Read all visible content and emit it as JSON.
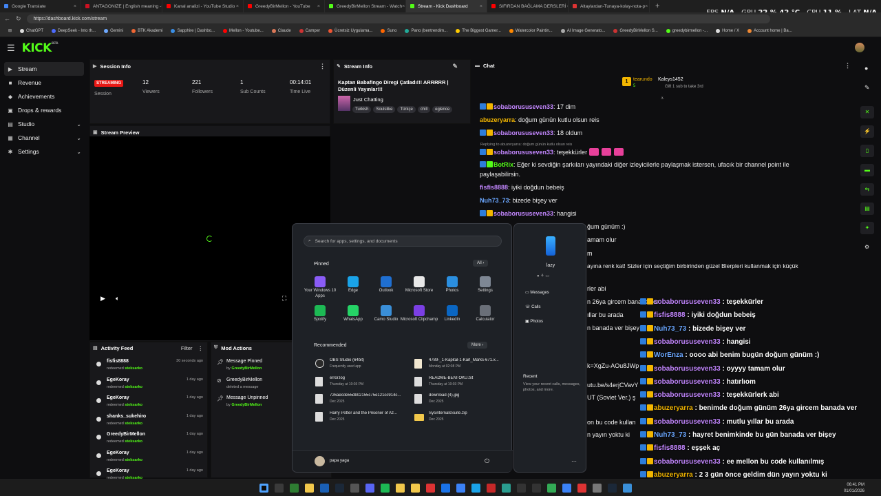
{
  "browser": {
    "tabs": [
      {
        "label": "Google Translate",
        "color": "#4285f4",
        "active": false
      },
      {
        "label": "ANTAGONIZE | English meaning -",
        "color": "#c12",
        "active": false
      },
      {
        "label": "Kanal analizi - YouTube Studio",
        "color": "#f00",
        "active": false
      },
      {
        "label": "GreedyBirMellon - YouTube",
        "color": "#f00",
        "active": false
      },
      {
        "label": "GreedyBirMellon Stream - Watch",
        "color": "#53fc18",
        "active": false
      },
      {
        "label": "Stream - Kick Dashboard",
        "color": "#53fc18",
        "active": true
      },
      {
        "label": "SIFIRDAN BAĞLAMA DERSLERİ 6",
        "color": "#f00",
        "active": false
      },
      {
        "label": "Altaylardan-Tunaya-kolay-nota-p",
        "color": "#d33",
        "active": false
      }
    ],
    "new_tab": "+",
    "url": "https://dashboard.kick.com/stream",
    "bookmarks": [
      {
        "label": "ChatGPT",
        "color": "#ddd"
      },
      {
        "label": "DeepSeek - Into th...",
        "color": "#4d6bfe"
      },
      {
        "label": "Gemini",
        "color": "#6ea8fe"
      },
      {
        "label": "BTK Akademi",
        "color": "#e63"
      },
      {
        "label": "Sapphire | Dashbo...",
        "color": "#3a8ee6"
      },
      {
        "label": "Mellon - Youtube...",
        "color": "#f00"
      },
      {
        "label": "Claude",
        "color": "#d97757"
      },
      {
        "label": "Camper",
        "color": "#c33"
      },
      {
        "label": "Ücretsiz Uygulama...",
        "color": "#e53"
      },
      {
        "label": "Suno",
        "color": "#f60"
      },
      {
        "label": "Pano (bentrendim...",
        "color": "#2a9"
      },
      {
        "label": "The Biggest Gamer...",
        "color": "#fc0"
      },
      {
        "label": "Watercolor Paintin...",
        "color": "#f80"
      },
      {
        "label": "AI Image Generato...",
        "color": "#aaa"
      },
      {
        "label": "GreedyBirMellon S...",
        "color": "#c33"
      },
      {
        "label": "greedybirmellon -...",
        "color": "#53fc18"
      },
      {
        "label": "Home / X",
        "color": "#ddd"
      },
      {
        "label": "Account home | Ba...",
        "color": "#e83"
      }
    ]
  },
  "hud": {
    "fps_label": "FPS",
    "fps_value": "N/A",
    "gpu_label": "GPU",
    "gpu_value": "22 % 42 °C",
    "cpu_label": "CPU",
    "cpu_value": "11 %",
    "lat_label": "LAT",
    "lat_value": "N/A"
  },
  "app": {
    "logo": "KICK",
    "logo_tag": "BETA"
  },
  "sidebar": {
    "items": [
      {
        "label": "Stream",
        "icon": "▶"
      },
      {
        "label": "Revenue",
        "icon": "■"
      },
      {
        "label": "Achievements",
        "icon": "◆"
      },
      {
        "label": "Drops & rewards",
        "icon": "▣"
      },
      {
        "label": "Studio",
        "icon": "▤"
      },
      {
        "label": "Channel",
        "icon": "▦"
      },
      {
        "label": "Settings",
        "icon": "✱"
      }
    ]
  },
  "session": {
    "title": "Session Info",
    "badge": "STREAMING",
    "session_label": "Session",
    "viewers": "12",
    "viewers_label": "Viewers",
    "followers": "221",
    "followers_label": "Followers",
    "subs": "1",
    "subs_label": "Sub Counts",
    "time": "00:14:01",
    "time_label": "Time Live"
  },
  "streaminfo": {
    "title": "Stream Info",
    "stream_title": "Kaptan Babafingo Diregi Çatladı!!! ARRRRR | Düzenli Yayınlar!!!",
    "category": "Just Chatting",
    "tags": [
      "Turkish",
      "Soulslike",
      "Türkçe",
      "chill",
      "eglence"
    ]
  },
  "preview": {
    "title": "Stream Preview"
  },
  "activity": {
    "title": "Activity Feed",
    "filter": "Filter",
    "rows": [
      {
        "name": "fisfis8888",
        "action": "redeemed",
        "reward": "steksarko",
        "time": "30 seconds ago"
      },
      {
        "name": "EgeKoray",
        "action": "redeemed",
        "reward": "steksarko",
        "time": "1 day ago"
      },
      {
        "name": "EgeKoray",
        "action": "redeemed",
        "reward": "steksarko",
        "time": "1 day ago"
      },
      {
        "name": "shanks_sukehiro",
        "action": "redeemed",
        "reward": "steksarko",
        "time": "1 day ago"
      },
      {
        "name": "GreedyBirMellon",
        "action": "redeemed",
        "reward": "steksarko",
        "time": "1 day ago"
      },
      {
        "name": "EgeKoray",
        "action": "redeemed",
        "reward": "steksarko",
        "time": "1 day ago"
      },
      {
        "name": "EgeKoray",
        "action": "redeemed",
        "reward": "steksarko",
        "time": "1 day ago"
      }
    ]
  },
  "mod": {
    "title": "Mod Actions",
    "rows": [
      {
        "title": "Message Pinned",
        "by": "by",
        "who": "GreedyBirMellon"
      },
      {
        "title": "GreedyBirMellon",
        "by": "deleted a message",
        "who": ""
      },
      {
        "title": "Message Unpinned",
        "by": "by",
        "who": "GreedyBirMellon"
      }
    ]
  },
  "chat": {
    "title": "Chat",
    "top_user": "tearundo",
    "top_count": "5",
    "top_user2": "Kaleys1452",
    "gift_text": "Gift 1 sub to take 3rd",
    "reply_note": "Replying to abuzeryarra: doğum günün kutlu olsun reis",
    "messages": [
      {
        "user": "sobaborususeven33",
        "color": "#c387ff",
        "badges": true,
        "text": ": 17 dim"
      },
      {
        "user": "abuzeryarra",
        "color": "#f3b600",
        "badges": false,
        "text": ": doğum günün kutlu olsun reis"
      },
      {
        "user": "sobaborususeven33",
        "color": "#c387ff",
        "badges": true,
        "text": ": 18 oldum"
      },
      {
        "user": "sobaborususeven33",
        "color": "#c387ff",
        "badges": true,
        "text": ": teşekkürler"
      },
      {
        "user": "BotRix",
        "color": "#53fc18",
        "badges": true,
        "text": ": Eğer ki sevdiğin şarkıları yayındaki diğer izleyicilerle paylaşmak istersen, ufacık bir channel point ile"
      },
      {
        "user": "",
        "color": "#eee",
        "badges": false,
        "text": "paylaşabilirsin."
      },
      {
        "user": "fisfis8888",
        "color": "#c387ff",
        "badges": false,
        "text": ": iyiki doğdun bebeiş"
      },
      {
        "user": "Nuh73_73",
        "color": "#6ba7ff",
        "badges": false,
        "text": ": bizede bişey ver"
      },
      {
        "user": "sobaborususeven33",
        "color": "#c387ff",
        "badges": true,
        "text": ": hangisi"
      }
    ],
    "behind": [
      "ğum günüm :)",
      "amam olur",
      "m",
      "ayına renk kat! Sizler için seçtiğim birbirinden güzel Blerpleri kullanmak için küçük",
      "rler abi",
      "n 26ya gircem banada ver",
      "ıllar bu arada",
      "n banada ver bişey",
      "k=XgZu-AOu8JWp",
      "utu.be/s4erjCVavY",
      "UT (Soviet Ver.) ş",
      "on bu code kullan",
      "n yayın yoktu ki"
    ]
  },
  "overlay": [
    {
      "user": "sobaborususeven33",
      "color": "#c387ff",
      "text": " : teşekkürler"
    },
    {
      "user": "fisfis8888",
      "color": "#c387ff",
      "text": " : iyiki doğdun bebeiş"
    },
    {
      "user": "Nuh73_73",
      "color": "#6ba7ff",
      "text": " : bizede bişey ver"
    },
    {
      "user": "sobaborususeven33",
      "color": "#c387ff",
      "text": " : hangisi"
    },
    {
      "user": "WorEnza",
      "color": "#6ba7ff",
      "text": " : oooo abi benim bugün doğum günüm :)"
    },
    {
      "user": "sobaborususeven33",
      "color": "#c387ff",
      "text": " : oyyyy tamam olur"
    },
    {
      "user": "sobaborususeven33",
      "color": "#c387ff",
      "text": " : hatırlıom"
    },
    {
      "user": "sobaborususeven33",
      "color": "#c387ff",
      "text": " : teşekkürlerk abi"
    },
    {
      "user": "abuzeryarra",
      "color": "#f3b600",
      "text": " : benimde doğum günüm 26ya gircem banada ver"
    },
    {
      "user": "sobaborususeven33",
      "color": "#c387ff",
      "text": " : mutlu yıllar bu arada"
    },
    {
      "user": "Nuh73_73",
      "color": "#6ba7ff",
      "text": " : hayret benimkinde bu gün banada ver bişey"
    },
    {
      "user": "fisfis8888",
      "color": "#c387ff",
      "text": " : eşşek aç"
    },
    {
      "user": "sobaborususeven33",
      "color": "#c387ff",
      "text": " : ee mellon bu code kullanılmış"
    },
    {
      "user": "abuzeryarra",
      "color": "#f3b600",
      "text": " : 2 3 gün önce geldim dün yayın yoktu ki"
    }
  ],
  "startmenu": {
    "search_placeholder": "Search for apps, settings, and documents",
    "pinned_label": "Pinned",
    "all_label": "All  ›",
    "pinned": [
      {
        "label": "Your Windows 10 Apps",
        "color": "#8a5cf6"
      },
      {
        "label": "Edge",
        "color": "#1aa3e8"
      },
      {
        "label": "Outlook",
        "color": "#1f6fd1"
      },
      {
        "label": "Microsoft Store",
        "color": "#e8e8e8"
      },
      {
        "label": "Photos",
        "color": "#2b8fe0"
      },
      {
        "label": "Settings",
        "color": "#7e8794"
      },
      {
        "label": "Spotify",
        "color": "#1db954"
      },
      {
        "label": "WhatsApp",
        "color": "#25d366"
      },
      {
        "label": "Camo Studio",
        "color": "#3a8fd8"
      },
      {
        "label": "Microsoft Clipchamp",
        "color": "#7b3fe4"
      },
      {
        "label": "LinkedIn",
        "color": "#0a66c2"
      },
      {
        "label": "Calculator",
        "color": "#6a6f78"
      }
    ],
    "recommended_label": "Recommended",
    "more_label": "More  ›",
    "recommended": [
      {
        "title": "OBS Studio (64bit)",
        "sub": "Frequently used app"
      },
      {
        "title": "4789-_1-Kapital-1-Karl_Marks-671.x...",
        "sub": "Monday at 02:08 PM"
      },
      {
        "title": "error.log",
        "sub": "Thursday at 10:03 PM"
      },
      {
        "title": "README-BENI OKU.txt",
        "sub": "Thursday at 10:03 PM"
      },
      {
        "title": "726aecde55db02155c75e121cc914c...",
        "sub": "Dec 2025"
      },
      {
        "title": "download (4).jpg",
        "sub": "Dec 2025"
      },
      {
        "title": "Harry Potter and the Prisoner of Az...",
        "sub": "Dec 2025"
      },
      {
        "title": "SysinternalsSuite.zip",
        "sub": "Dec 2025"
      }
    ],
    "user": "papa yaga",
    "power": "⏻"
  },
  "phonelink": {
    "device": "lazy",
    "items": [
      "Messages",
      "Calls",
      "Photos"
    ],
    "recent_title": "Recent",
    "recent_text": "View your recent calls, messages, photos, and more."
  },
  "taskbar": {
    "time": "06:41 PM",
    "date": "01/01/2026"
  }
}
